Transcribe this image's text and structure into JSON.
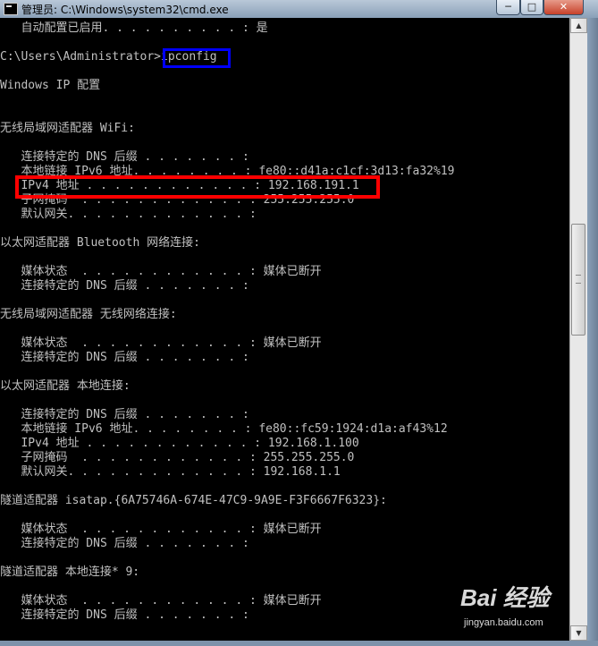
{
  "window": {
    "title": "管理员: C:\\Windows\\system32\\cmd.exe",
    "minimize_label": "─",
    "maximize_label": "□",
    "close_label": "✕"
  },
  "console": {
    "lines": [
      "   自动配置已启用. . . . . . . . . . : 是",
      "",
      "C:\\Users\\Administrator>ipconfig",
      "",
      "Windows IP 配置",
      "",
      "",
      "无线局域网适配器 WiFi:",
      "",
      "   连接特定的 DNS 后缀 . . . . . . . :",
      "   本地链接 IPv6 地址. . . . . . . . : fe80::d41a:c1cf:3d13:fa32%19",
      "   IPv4 地址 . . . . . . . . . . . . : 192.168.191.1",
      "   子网掩码  . . . . . . . . . . . . : 255.255.255.0",
      "   默认网关. . . . . . . . . . . . . :",
      "",
      "以太网适配器 Bluetooth 网络连接:",
      "",
      "   媒体状态  . . . . . . . . . . . . : 媒体已断开",
      "   连接特定的 DNS 后缀 . . . . . . . :",
      "",
      "无线局域网适配器 无线网络连接:",
      "",
      "   媒体状态  . . . . . . . . . . . . : 媒体已断开",
      "   连接特定的 DNS 后缀 . . . . . . . :",
      "",
      "以太网适配器 本地连接:",
      "",
      "   连接特定的 DNS 后缀 . . . . . . . :",
      "   本地链接 IPv6 地址. . . . . . . . : fe80::fc59:1924:d1a:af43%12",
      "   IPv4 地址 . . . . . . . . . . . . : 192.168.1.100",
      "   子网掩码  . . . . . . . . . . . . : 255.255.255.0",
      "   默认网关. . . . . . . . . . . . . : 192.168.1.1",
      "",
      "隧道适配器 isatap.{6A75746A-674E-47C9-9A9E-F3F6667F6323}:",
      "",
      "   媒体状态  . . . . . . . . . . . . : 媒体已断开",
      "   连接特定的 DNS 后缀 . . . . . . . :",
      "",
      "隧道适配器 本地连接* 9:",
      "",
      "   媒体状态  . . . . . . . . . . . . : 媒体已断开",
      "   连接特定的 DNS 后缀 . . . . . . . :"
    ]
  },
  "scrollbar": {
    "up_arrow": "▲",
    "down_arrow": "▼"
  },
  "watermark": {
    "logo": "Bai 经验",
    "url": "jingyan.baidu.com"
  },
  "colors": {
    "console_bg": "#000000",
    "console_text": "#c0c0c0",
    "highlight_command": "#0000ff",
    "highlight_ipv4": "#ff0000"
  }
}
